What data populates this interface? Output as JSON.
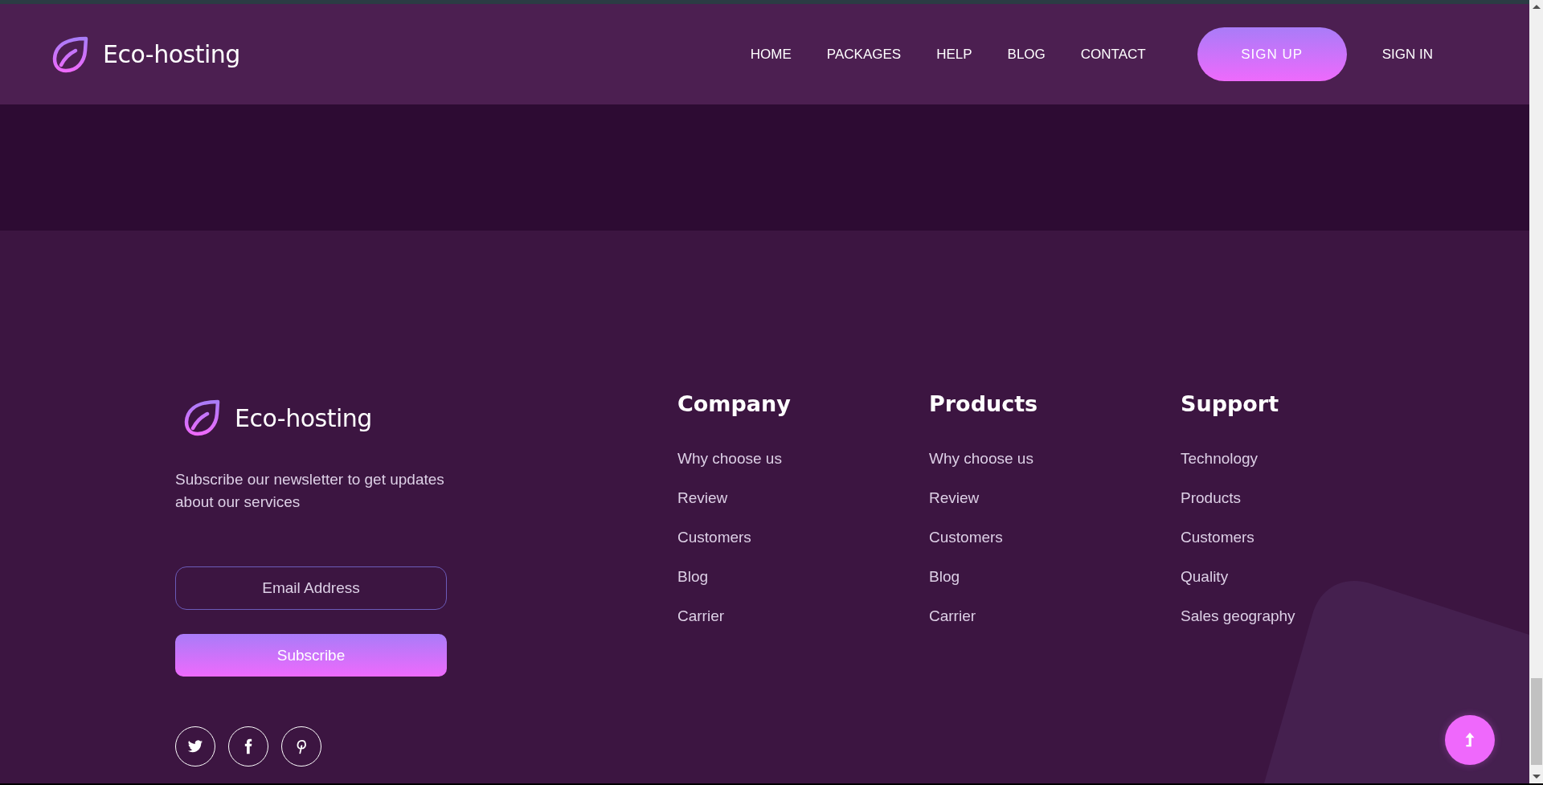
{
  "header": {
    "logo_text": "Eco-hosting",
    "nav": [
      {
        "label": "HOME"
      },
      {
        "label": "PACKAGES"
      },
      {
        "label": "HELP"
      },
      {
        "label": "BLOG"
      },
      {
        "label": "CONTACT"
      }
    ],
    "sign_up": "SIGN UP",
    "sign_in": "SIGN IN"
  },
  "footer": {
    "logo_text": "Eco-hosting",
    "newsletter_text": "Subscribe our newsletter to get updates about our services",
    "email_placeholder": "Email Address",
    "subscribe_button": "Subscribe",
    "columns": [
      {
        "title": "Company",
        "links": [
          "Why choose us",
          "Review",
          "Customers",
          "Blog",
          "Carrier"
        ]
      },
      {
        "title": "Products",
        "links": [
          "Why choose us",
          "Review",
          "Customers",
          "Blog",
          "Carrier"
        ]
      },
      {
        "title": "Support",
        "links": [
          "Technology",
          "Products",
          "Customers",
          "Quality",
          "Sales geography"
        ]
      }
    ]
  }
}
